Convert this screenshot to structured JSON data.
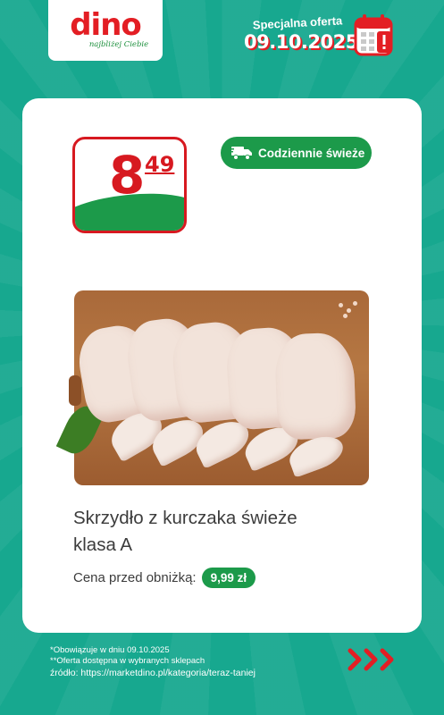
{
  "header": {
    "logo_text": "dino",
    "logo_tagline": "najbliżej Ciebie",
    "offer_label": "Specjalna oferta",
    "offer_date": "09.10.2025",
    "calendar_icon": "calendar-icon"
  },
  "product": {
    "price_main": "8",
    "price_cents": "49",
    "badge_label": "Codziennie świeże",
    "badge_icon": "truck-icon",
    "name_line1": "Skrzydło z kurczaka świeże",
    "name_line2": "klasa A",
    "prev_price_label": "Cena przed obniżką:",
    "prev_price_value": "9,99 zł",
    "image_icon": "chicken-wings-image"
  },
  "footer": {
    "note1": "*Obowiązuje w dniu 09.10.2025",
    "note2": "**Oferta dostępna w wybranych sklepach",
    "source": "źródło: https://marketdino.pl/kategoria/teraz-taniej",
    "arrows_icon": "chevron-right-icon"
  },
  "colors": {
    "background": "#17a88f",
    "brand_red": "#e31e24",
    "brand_green": "#1c9a4a"
  }
}
